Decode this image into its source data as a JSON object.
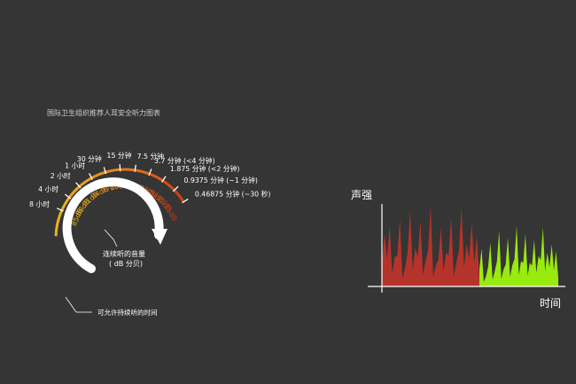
{
  "title": "国际卫生组织推荐人耳安全听力图表",
  "gauge": {
    "center_label": "连续听的音量",
    "center_sublabel": "( dB 分贝)",
    "bottom_label": "可允许持续听的时间",
    "levels": [
      {
        "db": "85dB",
        "time": "8 小时",
        "color": "#e9b11c"
      },
      {
        "db": "88dB",
        "time": "4 小时",
        "color": "#e9a91c"
      },
      {
        "db": "91dB",
        "time": "2 小时",
        "color": "#e89e1c"
      },
      {
        "db": "94dB",
        "time": "1 小时",
        "color": "#e7921b"
      },
      {
        "db": "97dB",
        "time": "30 分钟",
        "color": "#e5861a"
      },
      {
        "db": "100dB",
        "time": "15 分钟",
        "color": "#e27819"
      },
      {
        "db": "103dB",
        "time": "7.5 分钟",
        "color": "#de6a18"
      },
      {
        "db": "106dB",
        "time": "3.7 分钟 (<4 分钟)",
        "color": "#d85c17"
      },
      {
        "db": "109dB",
        "time": "1.875 分钟 (<2 分钟)",
        "color": "#d24e16"
      },
      {
        "db": "112dB",
        "time": "0.9375 分钟 (~1 分钟)",
        "color": "#cc4315"
      },
      {
        "db": "115dB",
        "time": "0.46875 分钟 (~30 秒)",
        "color": "#c63a14"
      }
    ]
  },
  "wave_chart": {
    "ylabel": "声强",
    "xlabel": "时间",
    "colors": {
      "loud": "#b5332a",
      "quiet": "#99ea0f"
    },
    "loud_peaks": [
      0.62,
      0.72,
      0.35,
      0.8,
      0.22,
      0.9,
      0.45,
      0.78,
      0.3,
      0.95,
      0.25,
      0.7,
      0.4,
      0.82,
      0.28,
      0.94,
      0.5,
      0.75,
      0.6
    ],
    "quiet_peaks": [
      0.45,
      0.12,
      0.52,
      0.18,
      0.66,
      0.2,
      0.58,
      0.25,
      0.72,
      0.3,
      0.62,
      0.28,
      0.55,
      0.36,
      0.7,
      0.4,
      0.5,
      0.42
    ]
  }
}
